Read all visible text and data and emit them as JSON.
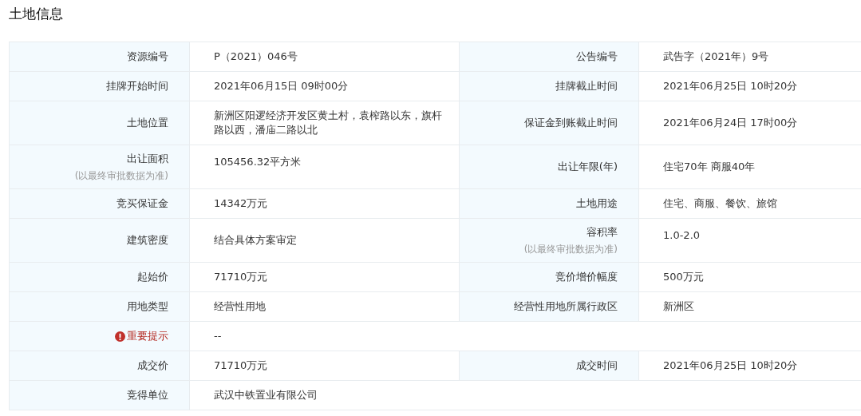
{
  "title": "土地信息",
  "rows": [
    {
      "cells": [
        {
          "label": "资源编号",
          "value": "P（2021）046号"
        },
        {
          "label": "公告编号",
          "value": "武告字（2021年）9号"
        }
      ]
    },
    {
      "cells": [
        {
          "label": "挂牌开始时间",
          "value": "2021年06月15日 09时00分"
        },
        {
          "label": "挂牌截止时间",
          "value": "2021年06月25日 10时20分"
        }
      ]
    },
    {
      "cells": [
        {
          "label": "土地位置",
          "value": "新洲区阳逻经济开发区黄土村，袁榨路以东，旗杆路以西，潘庙二路以北"
        },
        {
          "label": "保证金到账截止时间",
          "value": "2021年06月24日 17时00分"
        }
      ]
    },
    {
      "cells": [
        {
          "label": "出让面积",
          "note": "(以最终审批数据为准)",
          "value": "105456.32平方米"
        },
        {
          "label": "出让年限(年)",
          "value": "住宅70年 商服40年"
        }
      ]
    },
    {
      "cells": [
        {
          "label": "竞买保证金",
          "value": "14342万元"
        },
        {
          "label": "土地用途",
          "value": "住宅、商服、餐饮、旅馆"
        }
      ]
    },
    {
      "cells": [
        {
          "label": "建筑密度",
          "value": "结合具体方案审定"
        },
        {
          "label": "容积率",
          "note": "(以最终审批数据为准)",
          "value": "1.0-2.0"
        }
      ]
    },
    {
      "cells": [
        {
          "label": "起始价",
          "value": "71710万元"
        },
        {
          "label": "竞价增价幅度",
          "value": "500万元"
        }
      ]
    },
    {
      "cells": [
        {
          "label": "用地类型",
          "value": "经营性用地"
        },
        {
          "label": "经营性用地所属行政区",
          "value": "新洲区"
        }
      ]
    },
    {
      "cells": [
        {
          "label": "重要提示",
          "kind": "warning",
          "value": "--"
        }
      ]
    },
    {
      "cells": [
        {
          "label": "成交价",
          "value": "71710万元"
        },
        {
          "label": "成交时间",
          "value": "2021年06月25日 10时20分"
        }
      ]
    },
    {
      "cells": [
        {
          "label": "竞得单位",
          "value": "武汉中铁置业有限公司"
        }
      ]
    }
  ]
}
